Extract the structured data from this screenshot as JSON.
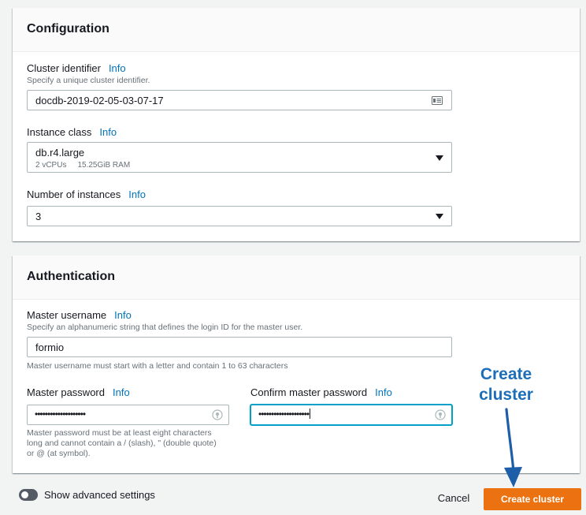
{
  "configuration": {
    "title": "Configuration",
    "cluster_identifier": {
      "label": "Cluster identifier",
      "info": "Info",
      "description": "Specify a unique cluster identifier.",
      "value": "docdb-2019-02-05-03-07-17",
      "icon": "id-card-icon"
    },
    "instance_class": {
      "label": "Instance class",
      "info": "Info",
      "value": "db.r4.large",
      "vcpus": "2 vCPUs",
      "ram": "15.25GiB RAM"
    },
    "number_of_instances": {
      "label": "Number of instances",
      "info": "Info",
      "value": "3"
    }
  },
  "authentication": {
    "title": "Authentication",
    "master_username": {
      "label": "Master username",
      "info": "Info",
      "description": "Specify an alphanumeric string that defines the login ID for the master user.",
      "value": "formio",
      "hint": "Master username must start with a letter and contain 1 to 63 characters"
    },
    "master_password": {
      "label": "Master password",
      "info": "Info",
      "masked_value": "••••••••••••••••••••",
      "hint_lines": [
        "Master password must be at least eight characters",
        "long and cannot contain a / (slash), \" (double quote)",
        "or @ (at symbol)."
      ],
      "icon": "password-manager-icon"
    },
    "confirm_master_password": {
      "label": "Confirm master password",
      "info": "Info",
      "masked_value": "••••••••••••••••••••",
      "icon": "password-manager-icon"
    }
  },
  "footer": {
    "advanced_settings_label": "Show advanced settings",
    "advanced_settings_enabled": false,
    "cancel_label": "Cancel",
    "create_label": "Create cluster"
  },
  "annotation": {
    "line1": "Create",
    "line2": "cluster"
  },
  "colors": {
    "primary_button": "#ec7211",
    "info_link": "#0073bb",
    "focus_ring": "#00a1c9",
    "annotation": "#1d6eb8",
    "toggle_off": "#545b64"
  }
}
